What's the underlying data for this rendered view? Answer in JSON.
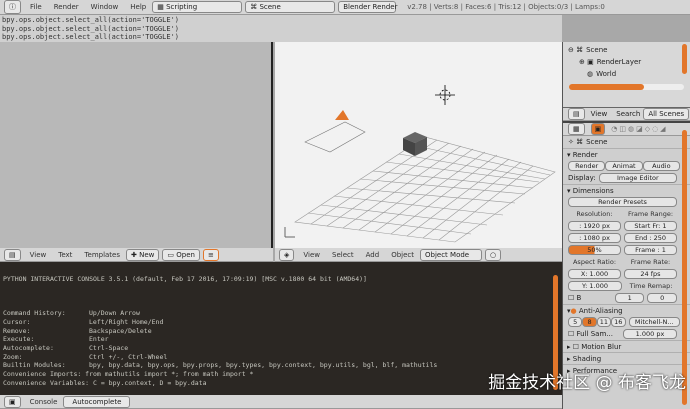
{
  "topbar": {
    "menus": [
      "File",
      "Render",
      "Window",
      "Help"
    ],
    "layout": "Scripting",
    "scene": "Scene",
    "engine": "Blender Render",
    "stats": "v2.78 | Verts:8 | Faces:6 | Tris:12 | Objects:0/3 | Lamps:0"
  },
  "info_log": [
    "bpy.ops.object.select_all(action='TOGGLE')",
    "bpy.ops.object.select_all(action='TOGGLE')",
    "bpy.ops.object.select_all(action='TOGGLE')"
  ],
  "text_header": {
    "menus": [
      "View",
      "Text",
      "Templates"
    ],
    "new": "New",
    "open": "Open"
  },
  "view3d_header": {
    "menus": [
      "View",
      "Select",
      "Add",
      "Object"
    ],
    "mode": "Object Mode"
  },
  "console": {
    "banner": "PYTHON INTERACTIVE CONSOLE 3.5.1 (default, Feb 17 2016, 17:09:19) [MSC v.1800 64 bit (AMD64)]",
    "lines": [
      [
        "Command History:",
        "Up/Down Arrow"
      ],
      [
        "Cursor:",
        "Left/Right Home/End"
      ],
      [
        "Remove:",
        "Backspace/Delete"
      ],
      [
        "Execute:",
        "Enter"
      ],
      [
        "Autocomplete:",
        "Ctrl-Space"
      ],
      [
        "Zoom:",
        "Ctrl +/-, Ctrl-Wheel"
      ],
      [
        "Builtin Modules:",
        "bpy, bpy.data, bpy.ops, bpy.props, bpy.types, bpy.context, bpy.utils, bgl, blf, mathutils"
      ]
    ],
    "imports": "Convenience Imports: from mathutils import *; from math import *",
    "vars": "Convenience Variables: C = bpy.context, D = bpy.data",
    "prompt": ">>> "
  },
  "console_bar": {
    "console": "Console",
    "autocomplete": "Autocomplete"
  },
  "outliner": {
    "items": [
      "Scene",
      "RenderLayer",
      "World"
    ],
    "view": "View",
    "search": "Search",
    "filter": "All Scenes"
  },
  "properties": {
    "context": "Scene",
    "render": {
      "title": "Render",
      "render": "Render",
      "animation": "Animat",
      "audio": "Audio",
      "display_label": "Display:",
      "display": "Image Editor"
    },
    "dimensions": {
      "title": "Dimensions",
      "presets": "Render Presets",
      "resolution": "Resolution:",
      "x": ": 1920 px",
      "y": ": 1080 px",
      "percent": "50%",
      "percent_value": 50,
      "frame_range": "Frame Range:",
      "start": "Start Fr: 1",
      "end": "End : 250",
      "frame": "Frame : 1",
      "aspect": "Aspect Ratio:",
      "ax": "X:  1.000",
      "ay": "Y:  1.000",
      "b": "B",
      "fps_label": "Frame Rate:",
      "fps": "24 fps",
      "remap": "Time Remap:",
      "r1": "1",
      "r2": "0"
    },
    "aa": {
      "title": "Anti-Aliasing",
      "samples": [
        "5",
        "8",
        "11",
        "16"
      ],
      "active": "8",
      "filter": "Mitchell-N...",
      "full": "Full Sam...",
      "size": "1.000 px"
    },
    "more": [
      "Motion Blur",
      "Shading",
      "Performance"
    ]
  },
  "watermark": "掘金技术社区 @ 布客飞龙"
}
